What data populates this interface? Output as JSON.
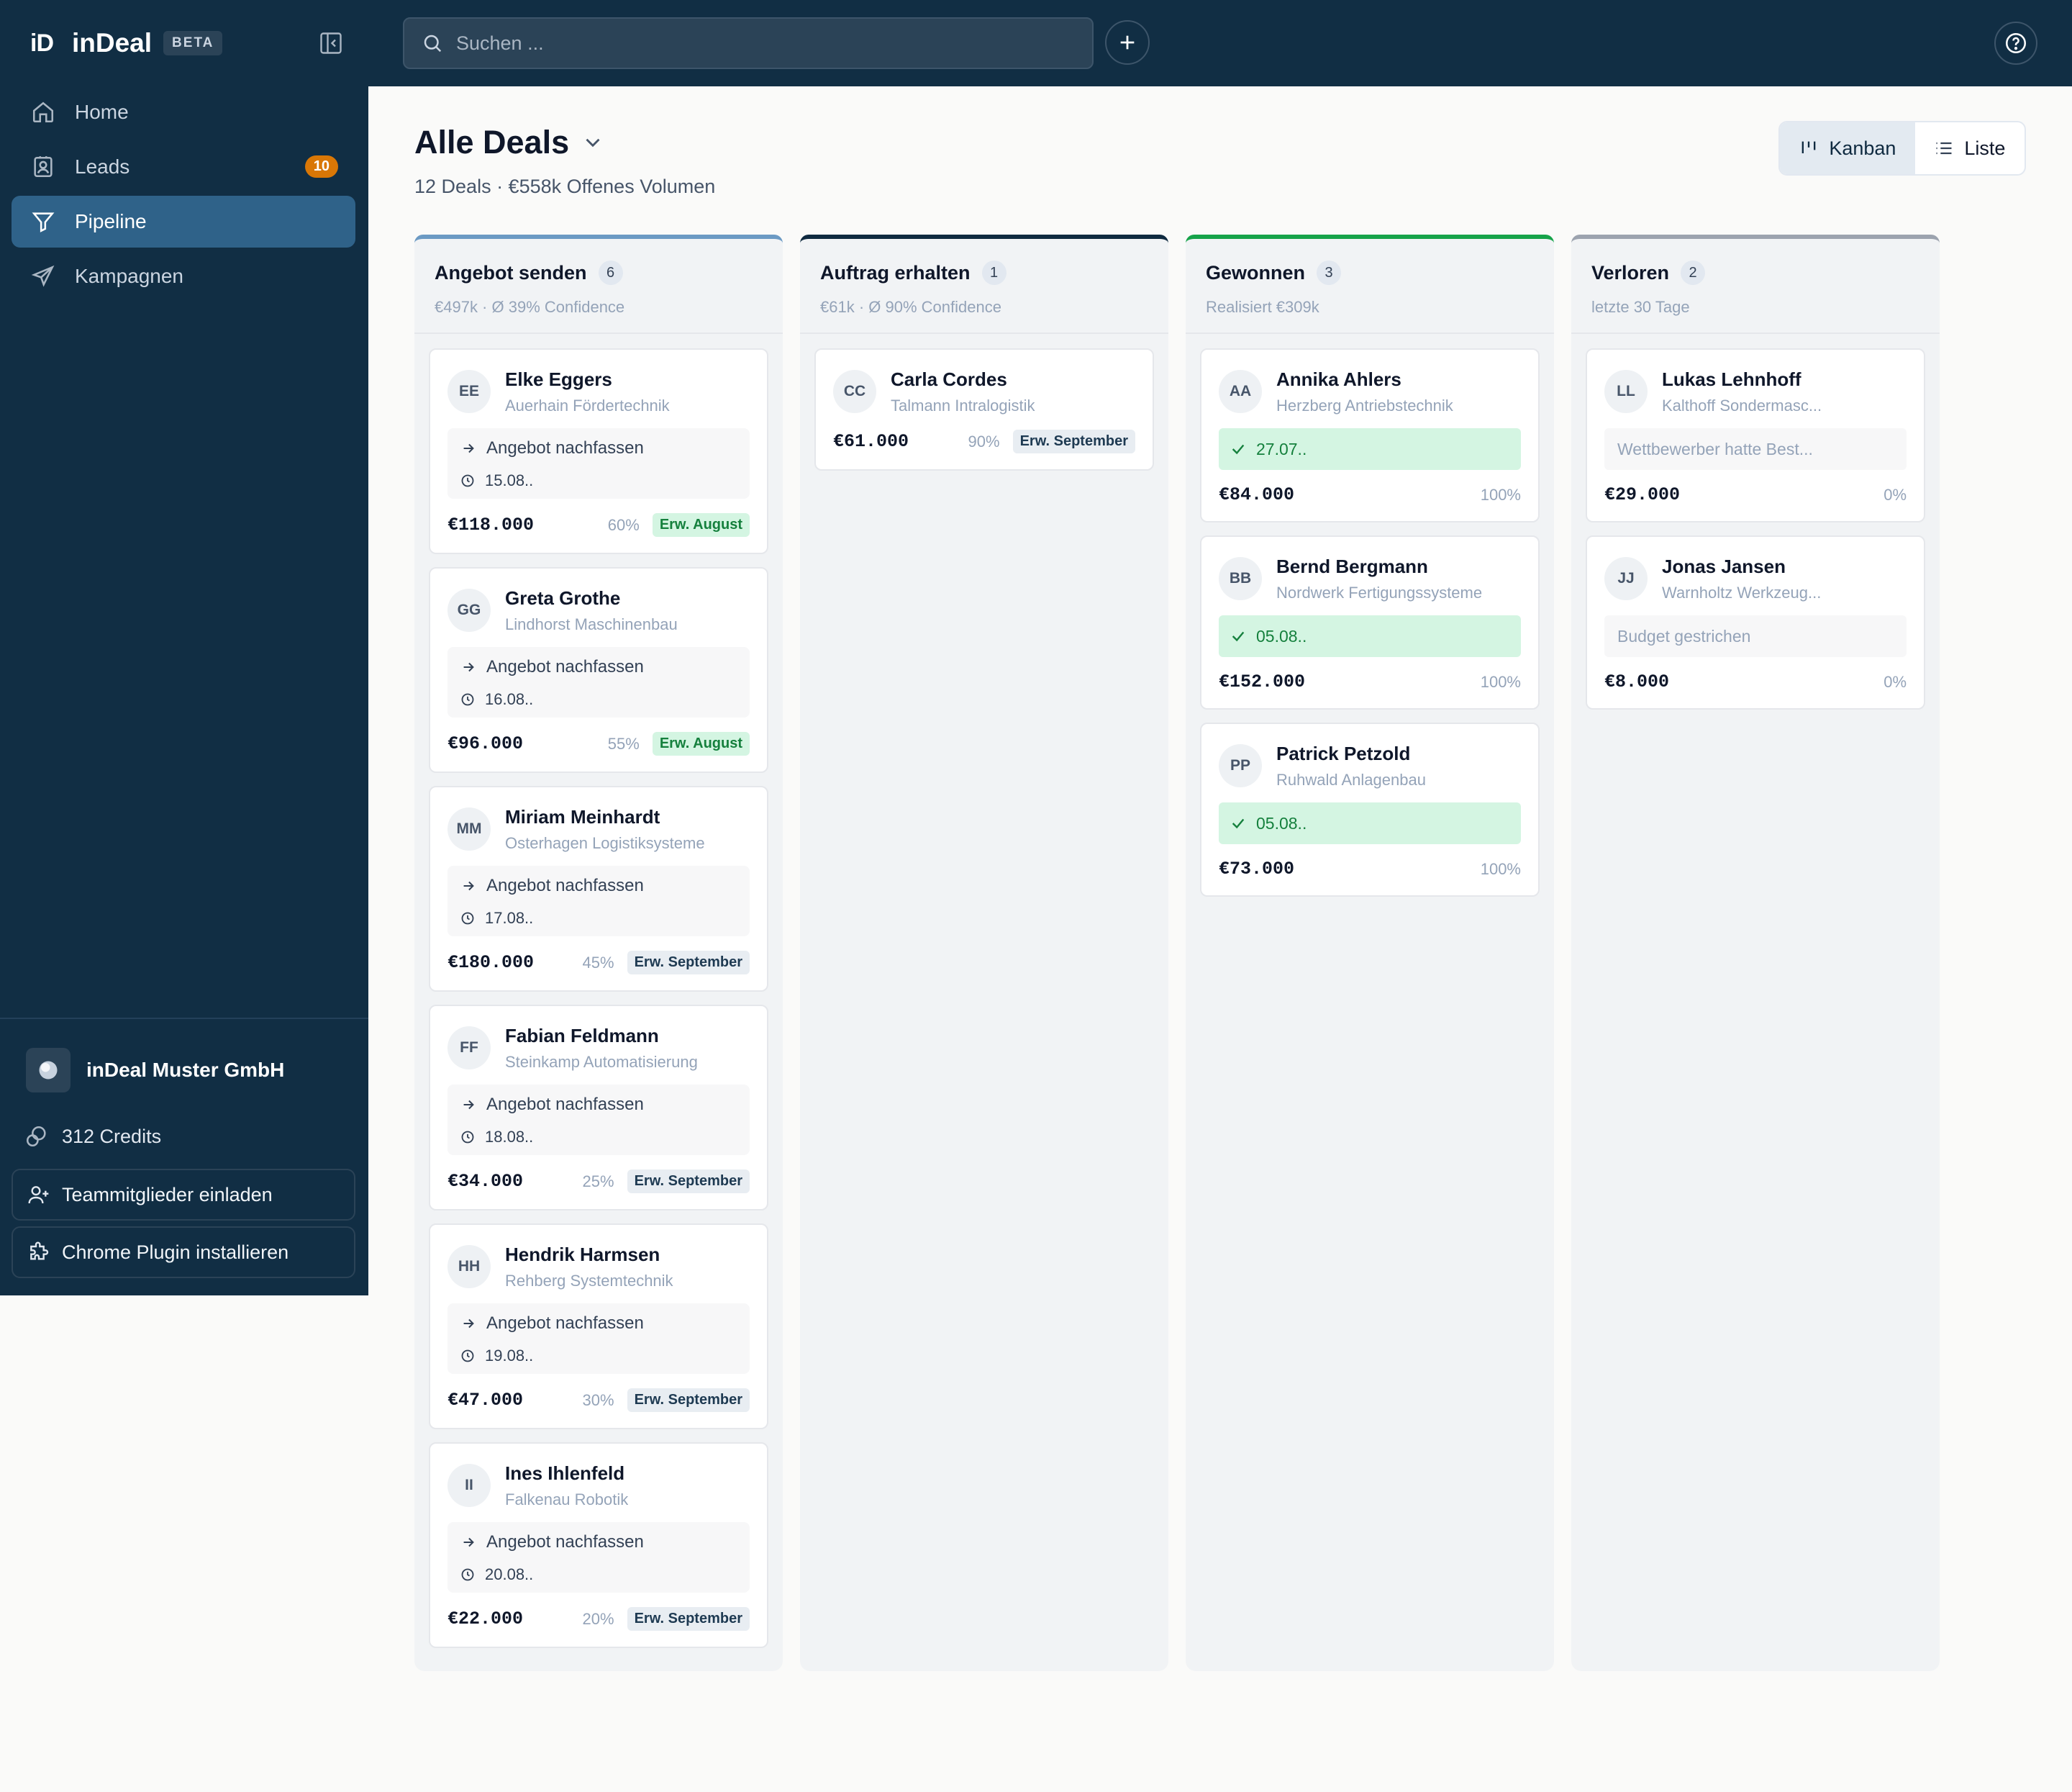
{
  "brand": {
    "mark": "iD",
    "name": "inDeal",
    "badge": "BETA"
  },
  "nav": [
    {
      "label": "Home",
      "icon": "home-icon"
    },
    {
      "label": "Leads",
      "icon": "contact-icon",
      "badge": "10"
    },
    {
      "label": "Pipeline",
      "icon": "funnel-icon",
      "active": true
    },
    {
      "label": "Kampagnen",
      "icon": "send-icon"
    }
  ],
  "sidebar_footer": {
    "company": "inDeal Muster GmbH",
    "credits": "312 Credits",
    "invite": "Teammitglieder einladen",
    "plugin": "Chrome Plugin installieren"
  },
  "search": {
    "placeholder": "Suchen ..."
  },
  "header": {
    "title": "Alle Deals",
    "subtitle": "12 Deals · €558k Offenes Volumen",
    "views": {
      "kanban": "Kanban",
      "liste": "Liste"
    }
  },
  "colors": {
    "sidebar": "#112e44",
    "accent": "#2f6289",
    "won": "#16a34a",
    "lost": "#9ca3af"
  },
  "columns": [
    {
      "title": "Angebot senden",
      "count": "6",
      "sub": "€497k · Ø 39% Confidence",
      "color": "#6b9ac4",
      "cards": [
        {
          "initials": "EE",
          "name": "Elke Eggers",
          "company": "Auerhain Fördertechnik",
          "task": "Angebot nachfassen",
          "date": "15.08..",
          "amount": "€118.000",
          "prob": "60%",
          "tag": "Erw. August"
        },
        {
          "initials": "GG",
          "name": "Greta Grothe",
          "company": "Lindhorst Maschinenbau",
          "task": "Angebot nachfassen",
          "date": "16.08..",
          "amount": "€96.000",
          "prob": "55%",
          "tag": "Erw. August"
        },
        {
          "initials": "MM",
          "name": "Miriam Meinhardt",
          "company": "Osterhagen Logistiksysteme",
          "task": "Angebot nachfassen",
          "date": "17.08..",
          "amount": "€180.000",
          "prob": "45%",
          "tag": "Erw. September"
        },
        {
          "initials": "FF",
          "name": "Fabian Feldmann",
          "company": "Steinkamp Automatisierung",
          "task": "Angebot nachfassen",
          "date": "18.08..",
          "amount": "€34.000",
          "prob": "25%",
          "tag": "Erw. September"
        },
        {
          "initials": "HH",
          "name": "Hendrik Harmsen",
          "company": "Rehberg Systemtechnik",
          "task": "Angebot nachfassen",
          "date": "19.08..",
          "amount": "€47.000",
          "prob": "30%",
          "tag": "Erw. September"
        },
        {
          "initials": "II",
          "name": "Ines Ihlenfeld",
          "company": "Falkenau Robotik",
          "task": "Angebot nachfassen",
          "date": "20.08..",
          "amount": "€22.000",
          "prob": "20%",
          "tag": "Erw. September"
        }
      ]
    },
    {
      "title": "Auftrag erhalten",
      "count": "1",
      "sub": "€61k · Ø 90% Confidence",
      "color": "#0f2a40",
      "cards": [
        {
          "initials": "CC",
          "name": "Carla Cordes",
          "company": "Talmann Intralogistik",
          "amount": "€61.000",
          "prob": "90%",
          "tag": "Erw. September"
        }
      ]
    },
    {
      "title": "Gewonnen",
      "count": "3",
      "sub": "Realisiert €309k",
      "color": "#16a34a",
      "cards": [
        {
          "initials": "AA",
          "name": "Annika Ahlers",
          "company": "Herzberg Antriebstechnik",
          "won": "27.07..",
          "amount": "€84.000",
          "prob": "100%"
        },
        {
          "initials": "BB",
          "name": "Bernd Bergmann",
          "company": "Nordwerk Fertigungssysteme",
          "won": "05.08..",
          "amount": "€152.000",
          "prob": "100%"
        },
        {
          "initials": "PP",
          "name": "Patrick Petzold",
          "company": "Ruhwald Anlagenbau",
          "won": "05.08..",
          "amount": "€73.000",
          "prob": "100%"
        }
      ]
    },
    {
      "title": "Verloren",
      "count": "2",
      "sub": "letzte 30 Tage",
      "color": "#9ca3af",
      "cards": [
        {
          "initials": "LL",
          "name": "Lukas Lehnhoff",
          "company": "Kalthoff Sondermasc...",
          "lost": "Wettbewerber hatte Best...",
          "amount": "€29.000",
          "prob": "0%"
        },
        {
          "initials": "JJ",
          "name": "Jonas Jansen",
          "company": "Warnholtz Werkzeug...",
          "lost": "Budget gestrichen",
          "amount": "€8.000",
          "prob": "0%"
        }
      ]
    }
  ]
}
